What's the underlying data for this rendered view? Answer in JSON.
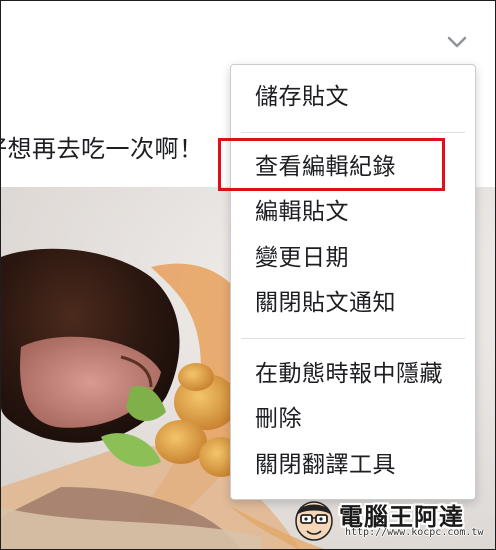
{
  "post": {
    "text": "好想再去吃一次啊！"
  },
  "icons": {
    "options": "chevron-down-icon",
    "watermark_logo": "cartoon-mascot-icon"
  },
  "menu": {
    "group1": [
      "儲存貼文"
    ],
    "group2": [
      "查看編輯紀錄",
      "編輯貼文",
      "變更日期",
      "關閉貼文通知"
    ],
    "group3": [
      "在動態時報中隱藏",
      "刪除",
      "關閉翻譯工具"
    ],
    "highlighted_item": "查看編輯紀錄"
  },
  "colors": {
    "highlight_border": "#e0101a",
    "text": "#1c1e21",
    "separator": "#dddfe2"
  },
  "watermark": {
    "title": "電腦王阿達",
    "url": "http://www.kocpc.com.tw"
  }
}
